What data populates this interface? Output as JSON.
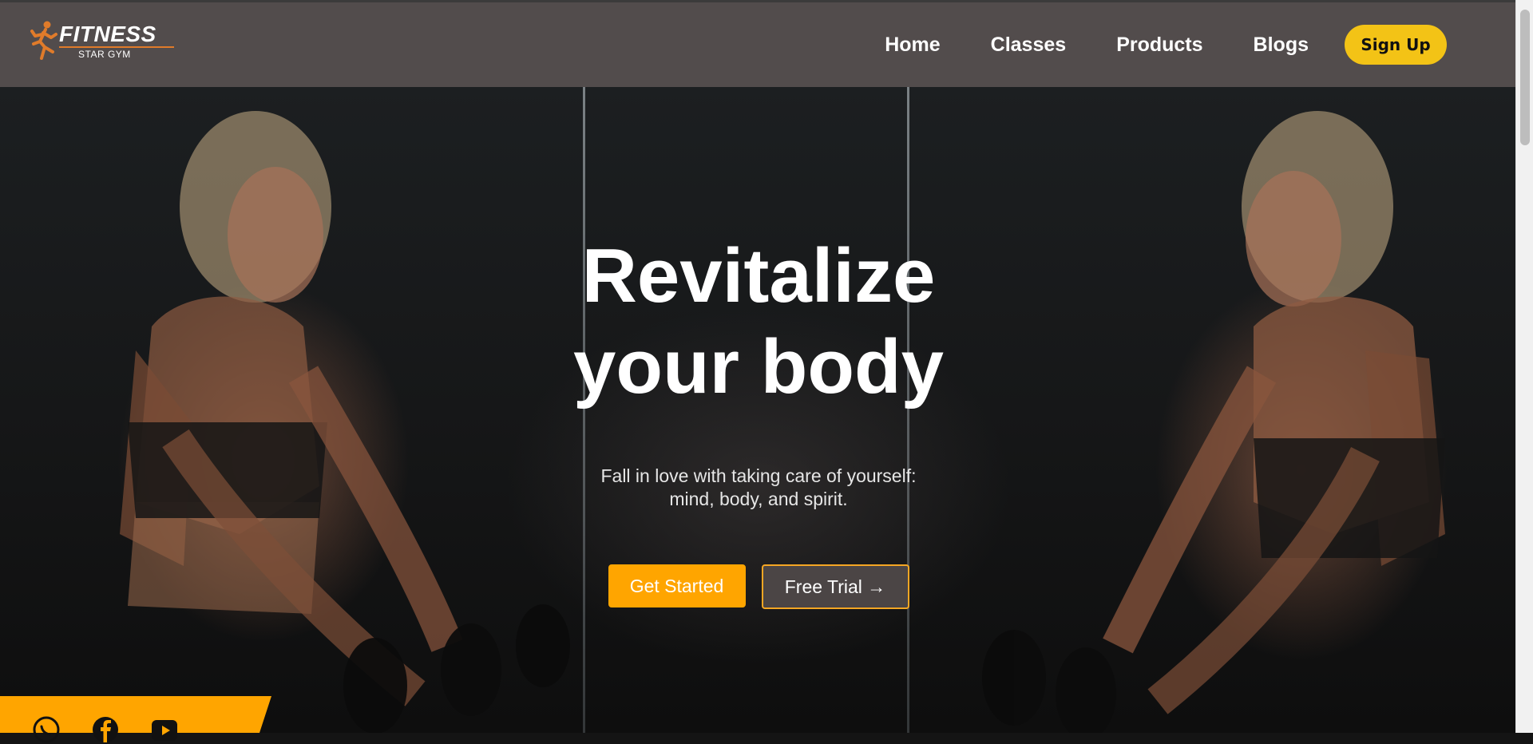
{
  "header": {
    "logo": {
      "title": "FITNESS",
      "subtitle": "STAR GYM",
      "icon": "runner-icon",
      "accent": "#e07b2a"
    },
    "nav": [
      {
        "label": "Home"
      },
      {
        "label": "Classes"
      },
      {
        "label": "Products"
      },
      {
        "label": "Blogs"
      }
    ],
    "signup_label": "Sign Up"
  },
  "hero": {
    "title_line1": "Revitalize",
    "title_line2": "your body",
    "subtitle_line1": "Fall in love with taking care of yourself:",
    "subtitle_line2": "mind, body, and spirit.",
    "primary_cta": "Get Started",
    "secondary_cta": "Free Trial →"
  },
  "social": {
    "icons": [
      "whatsapp-icon",
      "facebook-icon",
      "youtube-icon"
    ],
    "strip_color": "#ffa500"
  },
  "colors": {
    "header_bg": "#524c4c",
    "signup_bg": "#f3c316",
    "cta_orange": "#ffa500"
  }
}
